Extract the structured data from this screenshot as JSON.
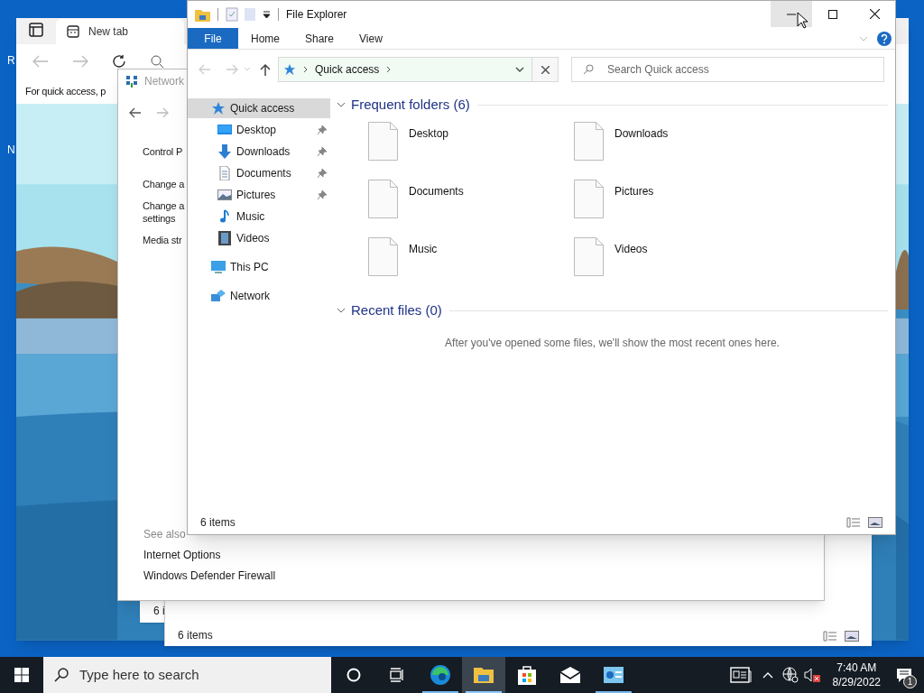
{
  "desktop": {
    "icon_labels": [
      "R",
      "N"
    ]
  },
  "browser": {
    "tab": "New tab",
    "page_text": "For quick access, p"
  },
  "back_windows": [
    {
      "status": "6 i"
    },
    {
      "status": "6 items"
    }
  ],
  "network_window": {
    "title": "Network",
    "tasks": [
      {
        "lines": [
          "Control P"
        ]
      },
      {
        "lines": [
          "Change a"
        ]
      },
      {
        "lines": [
          "Change a",
          "settings"
        ]
      },
      {
        "lines": [
          "Media str"
        ]
      }
    ],
    "see_also": {
      "heading": "See also",
      "links": [
        "Internet Options",
        "Windows Defender Firewall"
      ]
    }
  },
  "explorer": {
    "title": "File Explorer",
    "window_buttons": [
      {
        "kind": "minimize",
        "hovered": true
      },
      {
        "kind": "maximize",
        "hovered": false
      },
      {
        "kind": "close",
        "hovered": false
      }
    ],
    "ribbon_tabs": [
      {
        "label": "File",
        "selected": true
      },
      {
        "label": "Home",
        "selected": false
      },
      {
        "label": "Share",
        "selected": false
      },
      {
        "label": "View",
        "selected": false
      }
    ],
    "address": {
      "path": [
        "Quick access"
      ]
    },
    "search": {
      "placeholder": "Search Quick access"
    },
    "nav": [
      {
        "label": "Quick access",
        "selected": true,
        "children": [
          {
            "label": "Desktop",
            "pinned": true,
            "selected": false
          },
          {
            "label": "Downloads",
            "pinned": true,
            "selected": false
          },
          {
            "label": "Documents",
            "pinned": true,
            "selected": false
          },
          {
            "label": "Pictures",
            "pinned": true,
            "selected": false
          },
          {
            "label": "Music",
            "pinned": false,
            "selected": false
          },
          {
            "label": "Videos",
            "pinned": false,
            "selected": false
          }
        ]
      },
      {
        "label": "This PC",
        "selected": false
      },
      {
        "label": "Network",
        "selected": false
      }
    ],
    "sections": [
      {
        "kind": "folders",
        "title": "Frequent folders (6)",
        "expanded": true,
        "items": [
          "Desktop",
          "Downloads",
          "Documents",
          "Pictures",
          "Music",
          "Videos"
        ]
      },
      {
        "kind": "message",
        "title": "Recent files (0)",
        "expanded": true,
        "message": "After you've opened some files, we'll show the most recent ones here."
      }
    ],
    "status": "6 items"
  },
  "taskbar": {
    "search_placeholder": "Type here to search",
    "apps": [
      {
        "active": false,
        "running": true
      },
      {
        "active": true,
        "running": true
      },
      {
        "active": false,
        "running": false
      },
      {
        "active": false,
        "running": false
      },
      {
        "active": false,
        "running": true
      }
    ],
    "time": "7:40 AM",
    "date": "8/29/2022",
    "notification_count": "1"
  }
}
